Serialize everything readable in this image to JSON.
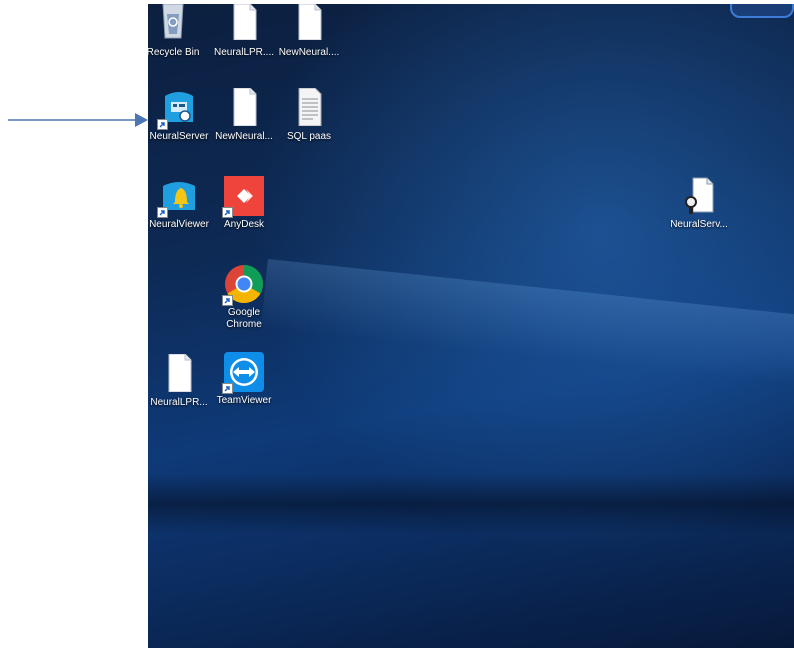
{
  "desktop": {
    "icons": [
      {
        "label": "Recycle Bin",
        "icon": "recycle-bin-icon"
      },
      {
        "label": "NeuralLPR....",
        "icon": "file-icon"
      },
      {
        "label": "NewNeural....",
        "icon": "file-icon"
      },
      {
        "label": "NeuralServer",
        "icon": "neural-server-icon",
        "shortcut": true
      },
      {
        "label": "NewNeural...",
        "icon": "file-icon"
      },
      {
        "label": "SQL paas",
        "icon": "text-document-icon"
      },
      {
        "label": "NeuralViewer",
        "icon": "neural-viewer-icon",
        "shortcut": true
      },
      {
        "label": "AnyDesk",
        "icon": "anydesk-icon",
        "shortcut": true
      },
      {
        "label": "NeuralServ...",
        "icon": "registry-key-file-icon"
      },
      {
        "label": "Google Chrome",
        "icon": "chrome-icon",
        "shortcut": true
      },
      {
        "label": "NeuralLPR...",
        "icon": "file-icon"
      },
      {
        "label": "TeamViewer",
        "icon": "teamviewer-icon",
        "shortcut": true
      }
    ]
  },
  "colors": {
    "arrow": "#4a77b4",
    "desktop_bg": "#0d2a55",
    "anydesk": "#ef443b",
    "teamviewer": "#0e8ee9"
  }
}
